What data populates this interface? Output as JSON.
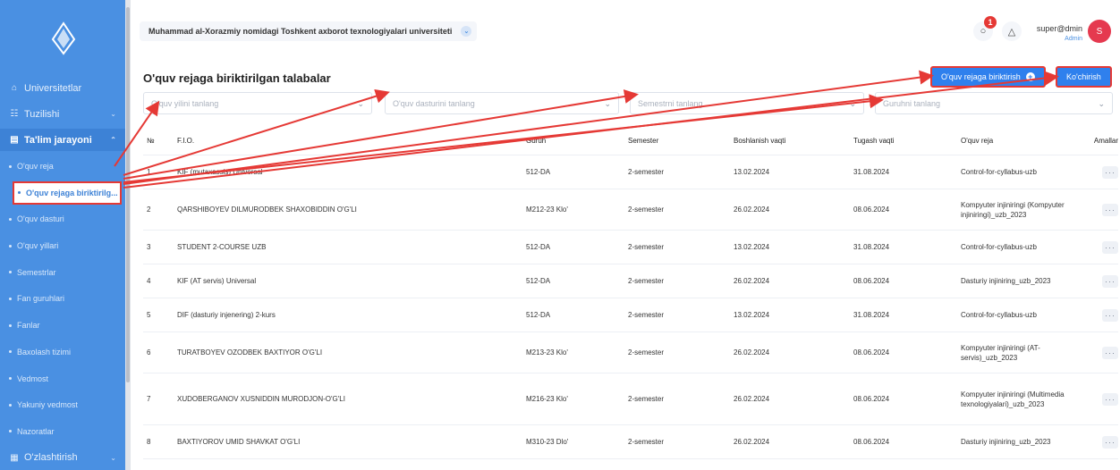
{
  "sidebar": {
    "logo_icon": "university-logo-icon",
    "items": [
      {
        "label": "Universitetlar",
        "icon": "bank-icon",
        "chevron": false
      },
      {
        "label": "Tuzilishi",
        "icon": "structure-icon",
        "chevron": true
      },
      {
        "label": "Ta'lim jarayoni",
        "icon": "education-icon",
        "chevron": true,
        "active": true
      }
    ],
    "sub_items": [
      {
        "label": "O'quv reja"
      },
      {
        "label": "O'quv rejaga biriktirilg...",
        "active": true
      },
      {
        "label": "O'quv dasturi"
      },
      {
        "label": "O'quv yillari"
      },
      {
        "label": "Semestrlar"
      },
      {
        "label": "Fan guruhlari"
      },
      {
        "label": "Fanlar"
      },
      {
        "label": "Baxolash tizimi"
      },
      {
        "label": "Vedmost"
      },
      {
        "label": "Yakuniy vedmost"
      },
      {
        "label": "Nazoratlar"
      }
    ],
    "footer_item": {
      "label": "O'zlashtirish",
      "icon": "progress-icon"
    }
  },
  "header": {
    "university": "Muhammad al-Xorazmiy nomidagi Toshkent axborot texnologiyalari universiteti",
    "message_badge": "1",
    "user_name": "super@dmin",
    "user_role": "Admin",
    "avatar_letter": "S"
  },
  "main": {
    "title": "O'quv rejaga biriktirilgan talabalar",
    "assign_button": "O'quv rejaga biriktirish",
    "move_button": "Ko'chirish",
    "filters": {
      "year": "O'quv yilini tanlang",
      "program": "O'quv dasturini tanlang",
      "semester": "Semestrni tanlang",
      "group": "Guruhni tanlang"
    },
    "columns": [
      "№",
      "F.I.O.",
      "Guruh",
      "Semester",
      "Boshlanish vaqti",
      "Tugash vaqti",
      "O'quv reja",
      "Amallar"
    ],
    "rows": [
      {
        "n": "1",
        "name": "KIF (mutaxassis) Universal",
        "group": "512-DA",
        "semester": "2-semester",
        "start": "13.02.2024",
        "end": "31.08.2024",
        "plan": "Control-for-cyllabus-uzb"
      },
      {
        "n": "2",
        "name": "QARSHIBOYEV DILMURODBEK SHAXOBIDDIN O'G'LI",
        "group": "M212-23 Klo'",
        "semester": "2-semester",
        "start": "26.02.2024",
        "end": "08.06.2024",
        "plan": "Kompyuter injiniringi (Kompyuter injiniringi)_uzb_2023"
      },
      {
        "n": "3",
        "name": "STUDENT 2-COURSE UZB",
        "group": "512-DA",
        "semester": "2-semester",
        "start": "13.02.2024",
        "end": "31.08.2024",
        "plan": "Control-for-cyllabus-uzb"
      },
      {
        "n": "4",
        "name": "KIF (AT servis) Universal",
        "group": "512-DA",
        "semester": "2-semester",
        "start": "26.02.2024",
        "end": "08.06.2024",
        "plan": "Dasturiy injiniring_uzb_2023"
      },
      {
        "n": "5",
        "name": "DIF (dasturiy injenering) 2-kurs",
        "group": "512-DA",
        "semester": "2-semester",
        "start": "13.02.2024",
        "end": "31.08.2024",
        "plan": "Control-for-cyllabus-uzb"
      },
      {
        "n": "6",
        "name": "TURATBOYEV OZODBEK BAXTIYOR O'G'LI",
        "group": "M213-23 Klo'",
        "semester": "2-semester",
        "start": "26.02.2024",
        "end": "08.06.2024",
        "plan": "Kompyuter injiniringi (AT-servis)_uzb_2023"
      },
      {
        "n": "7",
        "name": "XUDOBERGANOV XUSNIDDIN MURODJON-O'G'LI",
        "group": "M216-23 Klo'",
        "semester": "2-semester",
        "start": "26.02.2024",
        "end": "08.06.2024",
        "plan": "Kompyuter injiniringi (Multimedia texnologiyalari)_uzb_2023"
      },
      {
        "n": "8",
        "name": "BAXTIYOROV UMID SHAVKAT O'G'LI",
        "group": "M310-23 Dlo'",
        "semester": "2-semester",
        "start": "26.02.2024",
        "end": "08.06.2024",
        "plan": "Dasturiy injiniring_uzb_2023"
      }
    ]
  },
  "colors": {
    "sidebar": "#4a90e2",
    "primary": "#2f80ed",
    "annotation": "#e53935"
  }
}
